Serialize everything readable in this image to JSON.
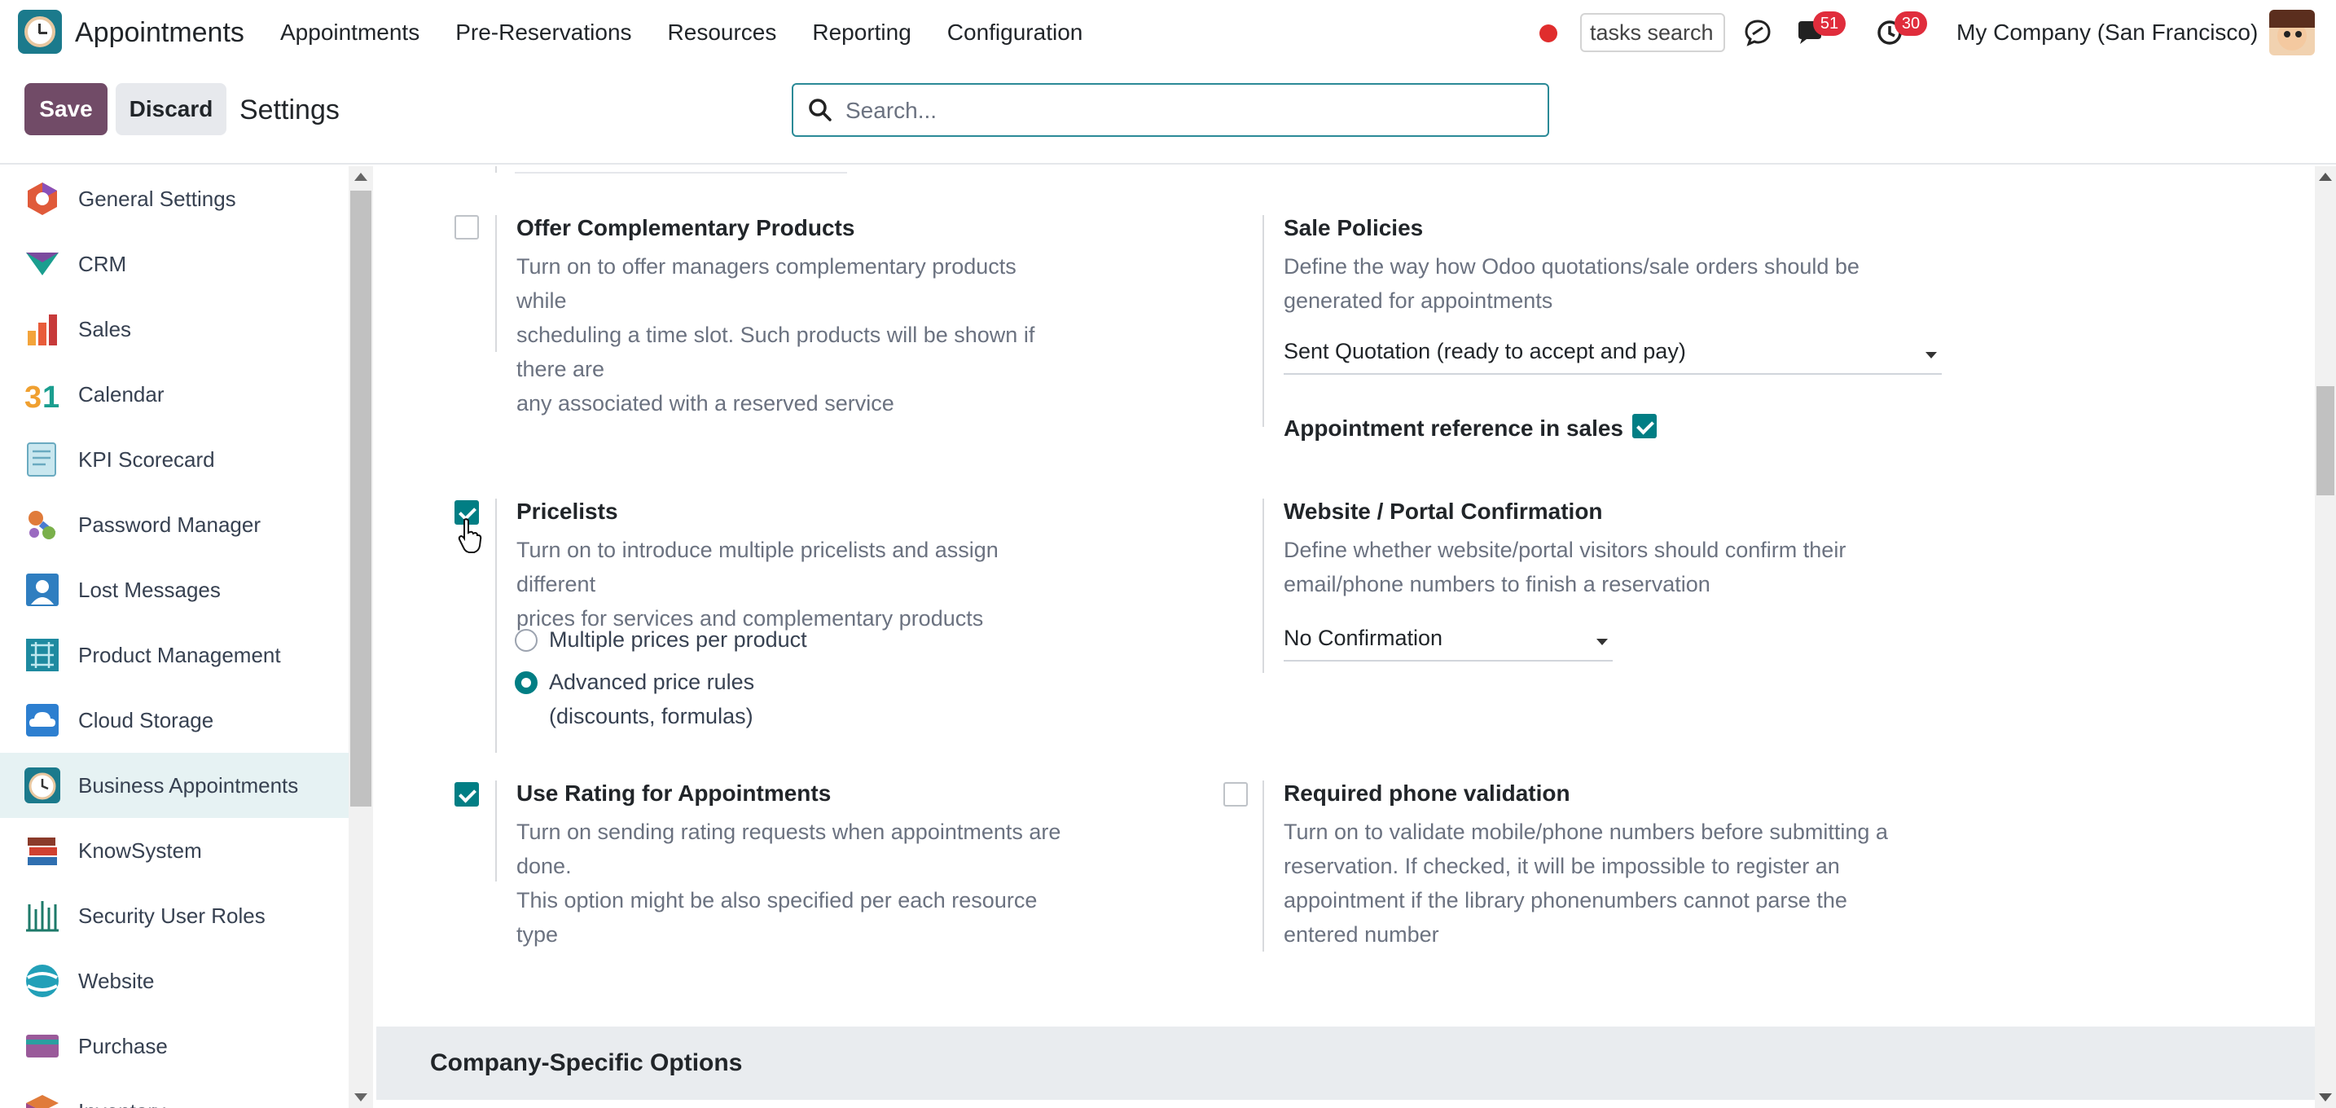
{
  "app": {
    "name": "Appointments"
  },
  "nav": {
    "menu": [
      "Appointments",
      "Pre-Reservations",
      "Resources",
      "Reporting",
      "Configuration"
    ],
    "tasks_search_value": "tasks search",
    "messages_count": "51",
    "activities_count": "30",
    "company": "My Company (San Francisco)"
  },
  "control": {
    "save_label": "Save",
    "discard_label": "Discard",
    "breadcrumb": "Settings",
    "search_placeholder": "Search..."
  },
  "sidebar": {
    "items": [
      {
        "label": "General Settings",
        "icon": "general-settings-icon"
      },
      {
        "label": "CRM",
        "icon": "crm-icon"
      },
      {
        "label": "Sales",
        "icon": "sales-icon"
      },
      {
        "label": "Calendar",
        "icon": "calendar-icon"
      },
      {
        "label": "KPI Scorecard",
        "icon": "kpi-scorecard-icon"
      },
      {
        "label": "Password Manager",
        "icon": "password-manager-icon"
      },
      {
        "label": "Lost Messages",
        "icon": "lost-messages-icon"
      },
      {
        "label": "Product Management",
        "icon": "product-management-icon"
      },
      {
        "label": "Cloud Storage",
        "icon": "cloud-storage-icon"
      },
      {
        "label": "Business Appointments",
        "icon": "business-appointments-icon",
        "active": true
      },
      {
        "label": "KnowSystem",
        "icon": "knowsystem-icon"
      },
      {
        "label": "Security User Roles",
        "icon": "security-user-roles-icon"
      },
      {
        "label": "Website",
        "icon": "website-icon"
      },
      {
        "label": "Purchase",
        "icon": "purchase-icon"
      },
      {
        "label": "Inventory",
        "icon": "inventory-icon"
      }
    ]
  },
  "settings": {
    "complementary": {
      "title": "Offer Complementary Products",
      "desc": [
        "Turn on to offer managers complementary products while",
        "scheduling a time slot. Such products will be shown if there are",
        "any associated with a reserved service"
      ],
      "checked": false
    },
    "sale_policies": {
      "title": "Sale Policies",
      "desc": [
        "Define the way how Odoo quotations/sale orders should be",
        "generated for appointments"
      ],
      "selected": "Sent Quotation (ready to accept and pay)",
      "ref_label": "Appointment reference in sales",
      "ref_checked": true
    },
    "pricelists": {
      "title": "Pricelists",
      "desc": [
        "Turn on to introduce multiple pricelists and assign different",
        "prices for services and complementary products"
      ],
      "checked": true,
      "options": [
        "Multiple prices per product",
        "Advanced price rules",
        "(discounts, formulas)"
      ],
      "selected_option": "Advanced price rules"
    },
    "website_confirmation": {
      "title": "Website / Portal Confirmation",
      "desc": [
        "Define whether website/portal visitors should confirm their",
        "email/phone numbers to finish a reservation"
      ],
      "selected": "No Confirmation"
    },
    "rating": {
      "title": "Use Rating for Appointments",
      "desc": [
        "Turn on sending rating requests when appointments are done.",
        "This option might be also specified per each resource type"
      ],
      "checked": true
    },
    "phone_validation": {
      "title": "Required phone validation",
      "desc": [
        "Turn on to validate mobile/phone numbers before submitting a",
        "reservation. If checked, it will be impossible to register an",
        "appointment if the library phonenumbers cannot parse the",
        "entered number"
      ],
      "checked": false
    }
  },
  "section": {
    "company_specific": "Company-Specific Options"
  },
  "colors": {
    "primary": "#714b67",
    "accent": "#017e84",
    "badge": "#e02d3c",
    "record": "#e02d2d"
  }
}
